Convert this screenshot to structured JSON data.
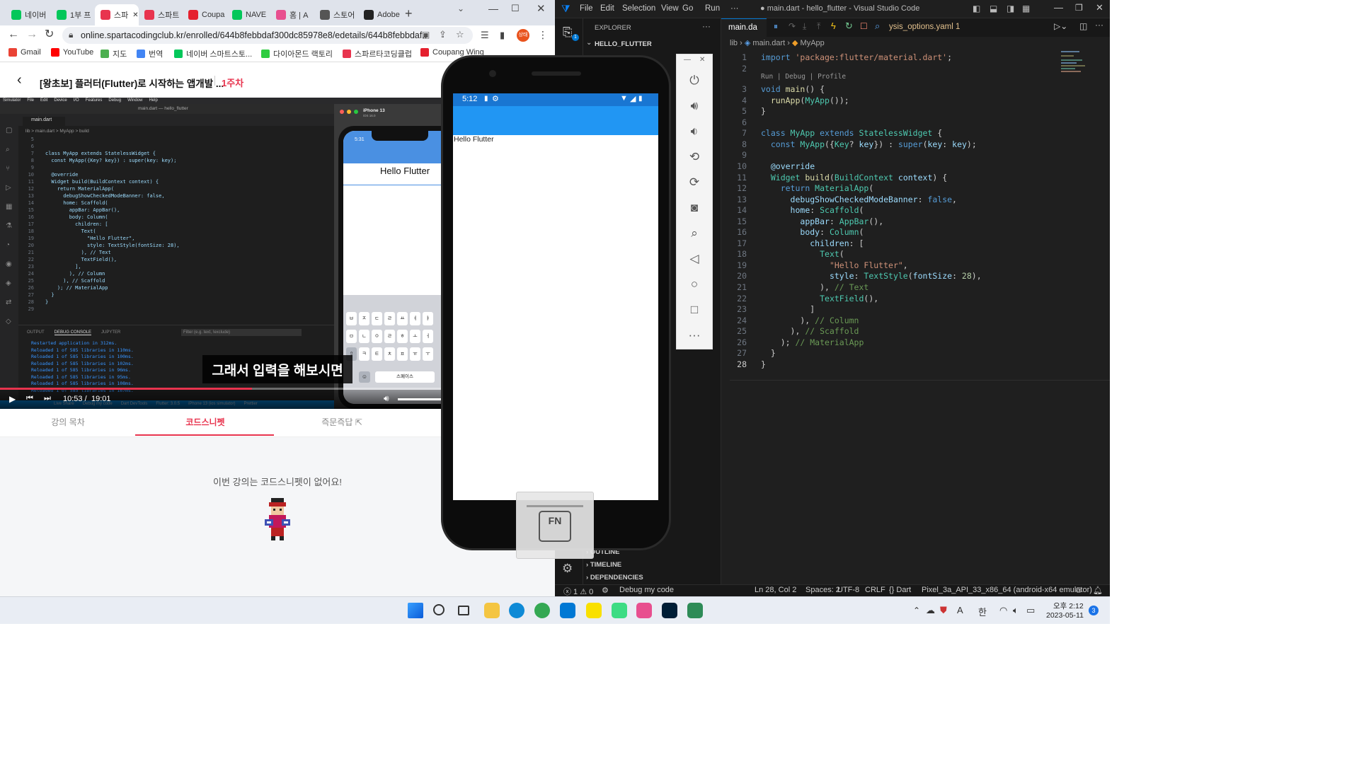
{
  "chrome": {
    "tabs": [
      {
        "label": "네이버",
        "color": "#03c75a"
      },
      {
        "label": "1부 프",
        "color": "#03c75a"
      },
      {
        "label": "스파",
        "color": "#e8344e",
        "active": true
      },
      {
        "label": "스파트",
        "color": "#e8344e"
      },
      {
        "label": "Coupa",
        "color": "#e5202e"
      },
      {
        "label": "NAVE",
        "color": "#03c75a"
      },
      {
        "label": "홈 | A",
        "color": "#e84f8f"
      },
      {
        "label": "스토어",
        "color": "#555555"
      },
      {
        "label": "Adobe",
        "color": "#222222"
      }
    ],
    "new_tab": "+",
    "url": "online.spartacodingclub.kr/enrolled/644b8febbdaf300dc85978e8/edetails/644b8febbdaf...",
    "profile": "상태",
    "bookmarks": [
      {
        "label": "Gmail",
        "color": "#ea4335"
      },
      {
        "label": "YouTube",
        "color": "#ff0000"
      },
      {
        "label": "지도",
        "color": "#4caf50"
      },
      {
        "label": "번역",
        "color": "#4285f4"
      },
      {
        "label": "네이버 스마트스토...",
        "color": "#03c75a"
      },
      {
        "label": "다이아몬드 랙토리",
        "color": "#2ecc40"
      },
      {
        "label": "스파르타코딩클럽",
        "color": "#e8344e"
      },
      {
        "label": "Coupang Wing",
        "color": "#e5202e"
      }
    ]
  },
  "lecture": {
    "title": "[왕초보] 플러터(Flutter)로 시작하는 앱개발 ...",
    "week": "1주차",
    "subtitle": "그래서 입력을 해보시면",
    "time_current": "10:53 /",
    "time_total": "19:01",
    "progress": 0.57,
    "tabs": [
      "강의 목차",
      "코드스니펫",
      "즉문즉답"
    ],
    "empty_message": "이번 강의는 코드스니펫이 없어요!"
  },
  "video_mac": {
    "menu": [
      "Simulator",
      "File",
      "Edit",
      "Device",
      "I/O",
      "Features",
      "Debug",
      "Window",
      "Help"
    ],
    "window_title": "main.dart — hello_flutter",
    "tab": "main.dart",
    "breadcrumb": "lib > main.dart > MyApp > build",
    "code": [
      [
        "5",
        ""
      ],
      [
        "6",
        ""
      ],
      [
        "7",
        "class MyApp extends StatelessWidget {"
      ],
      [
        "8",
        "  const MyApp({Key? key}) : super(key: key);"
      ],
      [
        "9",
        ""
      ],
      [
        "10",
        "  @override"
      ],
      [
        "11",
        "  Widget build(BuildContext context) {"
      ],
      [
        "12",
        "    return MaterialApp("
      ],
      [
        "13",
        "      debugShowCheckedModeBanner: false,"
      ],
      [
        "14",
        "      home: Scaffold("
      ],
      [
        "15",
        "        appBar: AppBar(),"
      ],
      [
        "16",
        "        body: Column("
      ],
      [
        "17",
        "          children: ["
      ],
      [
        "18",
        "            Text("
      ],
      [
        "19",
        "              \"Hello Flutter\","
      ],
      [
        "20",
        "              style: TextStyle(fontSize: 28),"
      ],
      [
        "21",
        "            ), // Text"
      ],
      [
        "22",
        "            TextField(),"
      ],
      [
        "23",
        "          ],"
      ],
      [
        "24",
        "        ), // Column"
      ],
      [
        "25",
        "      ), // Scaffold"
      ],
      [
        "26",
        "    ); // MaterialApp"
      ],
      [
        "27",
        "  }"
      ],
      [
        "28",
        "}"
      ],
      [
        "29",
        ""
      ]
    ],
    "panel_tabs": [
      "OUTPUT",
      "DEBUG CONSOLE",
      "JUPYTER"
    ],
    "filter_placeholder": "Filter (e.g. text, !exclude)",
    "console": [
      "Restarted application in 312ms.",
      "Reloaded 1 of 585 libraries in 110ms.",
      "Reloaded 1 of 585 libraries in 100ms.",
      "Reloaded 1 of 585 libraries in 102ms.",
      "Reloaded 1 of 585 libraries in 96ms.",
      "Reloaded 1 of 585 libraries in 95ms.",
      "Reloaded 1 of 585 libraries in 108ms.",
      "Reloaded 1 of 585 libraries in 167ms."
    ],
    "sim_name": "iPhone 13",
    "sim_os": "iOS 16.0",
    "sim_time": "5:31",
    "sim_text": "Hello Flutter",
    "keyboard_rows": [
      [
        "ㅂ",
        "ㅈ",
        "ㄷ",
        "ㄹ",
        "ㅛ",
        "ㅕ",
        "ㅑ"
      ],
      [
        "ㅁ",
        "ㄴ",
        "ㅇ",
        "ㄹ",
        "ㅎ",
        "ㅗ",
        "ㅓ"
      ],
      [
        "⇧",
        "ㅋ",
        "ㅌ",
        "ㅊ",
        "ㅍ",
        "ㅠ",
        "ㅜ"
      ]
    ],
    "space_label": "스페이스",
    "status_bottom": [
      "Live Share",
      "Debug my code",
      "Dart DevTools",
      "Flutter: 3.0.5",
      "iPhone 13 (ios simulator)",
      "Prettier"
    ]
  },
  "emulator": {
    "time": "5:12",
    "app_text": "Hello Flutter",
    "fn_label": "FN",
    "app_bar_color": "#2196f3"
  },
  "vscode": {
    "title": "● main.dart - hello_flutter - Visual Studio Code",
    "menu": [
      "File",
      "Edit",
      "Selection",
      "View",
      "Go",
      "Run",
      "···"
    ],
    "explorer_title": "EXPLORER",
    "project": "HELLO_FLUTTER",
    "sections": [
      "OUTLINE",
      "TIMELINE",
      "DEPENDENCIES"
    ],
    "tab_main": "main.da",
    "tab_other": "ysis_options.yaml 1",
    "breadcrumb": [
      "lib",
      "main.dart",
      "MyApp"
    ],
    "codelens": "Run | Debug | Profile",
    "code": [
      [
        {
          "t": "import ",
          "c": "kw"
        },
        {
          "t": "'package:flutter/material.dart'",
          "c": "st"
        },
        {
          "t": ";",
          "c": ""
        }
      ],
      [],
      [
        {
          "t": "void ",
          "c": "kw"
        },
        {
          "t": "main",
          "c": "fn"
        },
        {
          "t": "() {",
          "c": ""
        }
      ],
      [
        {
          "t": "  ",
          "c": ""
        },
        {
          "t": "runApp",
          "c": "fn"
        },
        {
          "t": "(",
          "c": ""
        },
        {
          "t": "MyApp",
          "c": "ty"
        },
        {
          "t": "());",
          "c": ""
        }
      ],
      [
        {
          "t": "}",
          "c": ""
        }
      ],
      [],
      [
        {
          "t": "class ",
          "c": "kw"
        },
        {
          "t": "MyApp ",
          "c": "ty"
        },
        {
          "t": "extends ",
          "c": "kw"
        },
        {
          "t": "StatelessWidget ",
          "c": "ty"
        },
        {
          "t": "{",
          "c": ""
        }
      ],
      [
        {
          "t": "  ",
          "c": ""
        },
        {
          "t": "const ",
          "c": "kw"
        },
        {
          "t": "MyApp",
          "c": "ty"
        },
        {
          "t": "({",
          "c": ""
        },
        {
          "t": "Key",
          "c": "ty"
        },
        {
          "t": "? ",
          "c": ""
        },
        {
          "t": "key",
          "c": "pm"
        },
        {
          "t": "}) : ",
          "c": ""
        },
        {
          "t": "super",
          "c": "kw"
        },
        {
          "t": "(",
          "c": ""
        },
        {
          "t": "key",
          "c": "pm"
        },
        {
          "t": ": ",
          "c": ""
        },
        {
          "t": "key",
          "c": "pm"
        },
        {
          "t": ");",
          "c": ""
        }
      ],
      [],
      [
        {
          "t": "  @override",
          "c": "pm"
        }
      ],
      [
        {
          "t": "  ",
          "c": ""
        },
        {
          "t": "Widget ",
          "c": "ty"
        },
        {
          "t": "build",
          "c": "fn"
        },
        {
          "t": "(",
          "c": ""
        },
        {
          "t": "BuildContext ",
          "c": "ty"
        },
        {
          "t": "context",
          "c": "pm"
        },
        {
          "t": ") {",
          "c": ""
        }
      ],
      [
        {
          "t": "    ",
          "c": ""
        },
        {
          "t": "return ",
          "c": "kw"
        },
        {
          "t": "MaterialApp",
          "c": "ty"
        },
        {
          "t": "(",
          "c": ""
        }
      ],
      [
        {
          "t": "      ",
          "c": ""
        },
        {
          "t": "debugShowCheckedModeBanner",
          "c": "pm"
        },
        {
          "t": ": ",
          "c": ""
        },
        {
          "t": "false",
          "c": "kw"
        },
        {
          "t": ",",
          "c": ""
        }
      ],
      [
        {
          "t": "      ",
          "c": ""
        },
        {
          "t": "home",
          "c": "pm"
        },
        {
          "t": ": ",
          "c": ""
        },
        {
          "t": "Scaffold",
          "c": "ty"
        },
        {
          "t": "(",
          "c": ""
        }
      ],
      [
        {
          "t": "        ",
          "c": ""
        },
        {
          "t": "appBar",
          "c": "pm"
        },
        {
          "t": ": ",
          "c": ""
        },
        {
          "t": "AppBar",
          "c": "ty"
        },
        {
          "t": "(),",
          "c": ""
        }
      ],
      [
        {
          "t": "        ",
          "c": ""
        },
        {
          "t": "body",
          "c": "pm"
        },
        {
          "t": ": ",
          "c": ""
        },
        {
          "t": "Column",
          "c": "ty"
        },
        {
          "t": "(",
          "c": ""
        }
      ],
      [
        {
          "t": "          ",
          "c": ""
        },
        {
          "t": "children",
          "c": "pm"
        },
        {
          "t": ": [",
          "c": ""
        }
      ],
      [
        {
          "t": "            ",
          "c": ""
        },
        {
          "t": "Text",
          "c": "ty"
        },
        {
          "t": "(",
          "c": ""
        }
      ],
      [
        {
          "t": "              ",
          "c": ""
        },
        {
          "t": "\"Hello Flutter\"",
          "c": "st"
        },
        {
          "t": ",",
          "c": ""
        }
      ],
      [
        {
          "t": "              ",
          "c": ""
        },
        {
          "t": "style",
          "c": "pm"
        },
        {
          "t": ": ",
          "c": ""
        },
        {
          "t": "TextStyle",
          "c": "ty"
        },
        {
          "t": "(",
          "c": ""
        },
        {
          "t": "fontSize",
          "c": "pm"
        },
        {
          "t": ": ",
          "c": ""
        },
        {
          "t": "28",
          "c": "nm"
        },
        {
          "t": "),",
          "c": ""
        }
      ],
      [
        {
          "t": "            ), ",
          "c": ""
        },
        {
          "t": "// Text",
          "c": "cm"
        }
      ],
      [
        {
          "t": "            ",
          "c": ""
        },
        {
          "t": "TextField",
          "c": "ty"
        },
        {
          "t": "(),",
          "c": ""
        }
      ],
      [
        {
          "t": "          ]",
          "c": ""
        }
      ],
      [
        {
          "t": "        ), ",
          "c": ""
        },
        {
          "t": "// Column",
          "c": "cm"
        }
      ],
      [
        {
          "t": "      ), ",
          "c": ""
        },
        {
          "t": "// Scaffold",
          "c": "cm"
        }
      ],
      [
        {
          "t": "    ); ",
          "c": ""
        },
        {
          "t": "// MaterialApp",
          "c": "cm"
        }
      ],
      [
        {
          "t": "  }",
          "c": ""
        }
      ],
      [
        {
          "t": "}",
          "c": ""
        }
      ]
    ],
    "status": {
      "problems": "ⓧ 1 ⚠ 0",
      "debug": "Debug my code",
      "pos": "Ln 28, Col 2",
      "spaces": "Spaces: 2",
      "enc": "UTF-8",
      "eol": "CRLF",
      "lang": "{} Dart",
      "device": "Pixel_3a_API_33_x86_64 (android-x64 emulator)"
    }
  },
  "taskbar": {
    "clock_ampm_time": "오후 2:12",
    "date": "2023-05-11",
    "ime": "한",
    "ime2": "A",
    "notif": "3",
    "apps": [
      {
        "name": "start-icon",
        "color": "#1a73e8"
      },
      {
        "name": "search-icon",
        "color": "#333333"
      },
      {
        "name": "taskview-icon",
        "color": "#333333"
      },
      {
        "name": "explorer-icon",
        "color": "#f4c542"
      },
      {
        "name": "edge-icon",
        "color": "#0f8ad6"
      },
      {
        "name": "chrome-icon",
        "color": "#34a853"
      },
      {
        "name": "vscode-icon",
        "color": "#0078d4"
      },
      {
        "name": "kakaotalk-icon",
        "color": "#f9e000"
      },
      {
        "name": "android-studio-icon",
        "color": "#3ddc84"
      },
      {
        "name": "paint-icon",
        "color": "#e84f8f"
      },
      {
        "name": "photoshop-icon",
        "color": "#001e36"
      },
      {
        "name": "charts-icon",
        "color": "#2e8b57"
      }
    ]
  }
}
